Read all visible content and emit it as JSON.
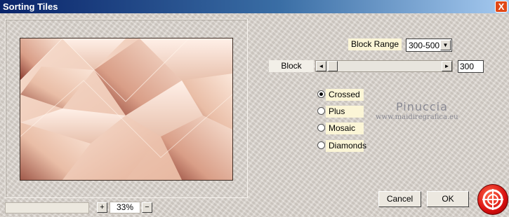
{
  "window": {
    "title": "Sorting Tiles",
    "close_glyph": "X"
  },
  "controls": {
    "block_range_label": "Block Range",
    "block_range_value": "300-500",
    "block_label": "Block",
    "block_value": "300",
    "slider_left_glyph": "◄",
    "slider_right_glyph": "►",
    "dropdown_glyph": "▼"
  },
  "modes": [
    {
      "label": "Crossed",
      "selected": true
    },
    {
      "label": "Plus",
      "selected": false
    },
    {
      "label": "Mosaic",
      "selected": false
    },
    {
      "label": "Diamonds",
      "selected": false
    }
  ],
  "watermark": {
    "name": "Pinuccia",
    "url": "www.maidiregrafica.eu"
  },
  "zoom": {
    "value": "33%",
    "plus": "+",
    "minus": "−"
  },
  "buttons": {
    "cancel": "Cancel",
    "ok": "OK"
  },
  "colors": {
    "title_bar": "#0a246a",
    "label_bg": "#fbf5d6",
    "logo": "#d81010"
  }
}
